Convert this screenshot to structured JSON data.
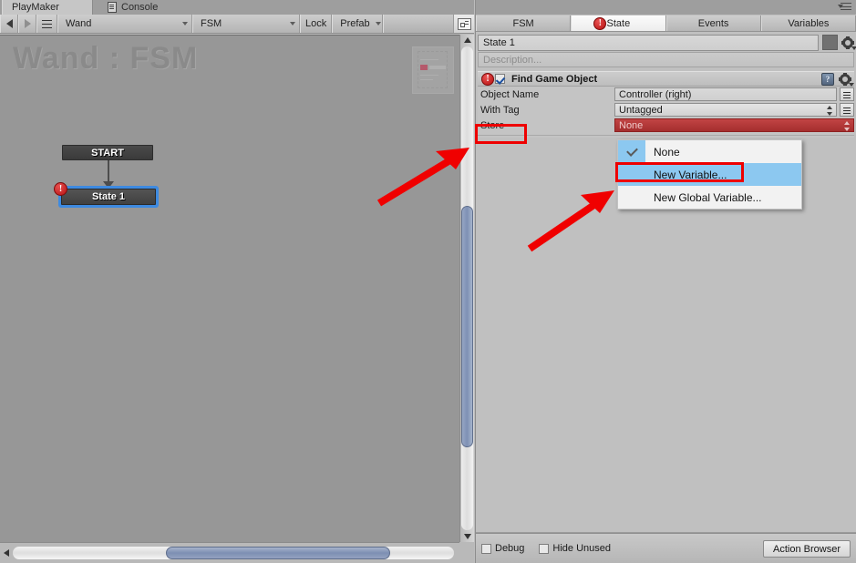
{
  "window_tabs": [
    {
      "label": "PlayMaker",
      "active": true,
      "icon": ""
    },
    {
      "label": "Console",
      "active": false,
      "icon": "console-doc-icon"
    }
  ],
  "toolbar": {
    "back_icon": "triangle-left-icon",
    "forward_icon": "triangle-right-icon",
    "menu_icon": "hamburger-icon",
    "game_object_selector": "Wand",
    "fsm_selector": "FSM",
    "lock_label": "Lock",
    "prefab_label": "Prefab",
    "layout_icon": "layout-icon"
  },
  "graph": {
    "title": "Wand : FSM",
    "start_node": "START",
    "state_node": "State 1",
    "state_error_badge": "!",
    "minimap_name": "minimap"
  },
  "right_panel": {
    "tabs": [
      {
        "label": "FSM",
        "active": false,
        "has_error": false
      },
      {
        "label": "State",
        "active": true,
        "has_error": true
      },
      {
        "label": "Events",
        "active": false,
        "has_error": false
      },
      {
        "label": "Variables",
        "active": false,
        "has_error": false
      }
    ],
    "state_name": "State 1",
    "description_placeholder": "Description...",
    "color_swatch": "#717171",
    "action": {
      "title": "Find Game Object",
      "enabled": true,
      "error_badge": "!",
      "help_label": "?",
      "properties": [
        {
          "label": "Object Name",
          "value": "Controller (right)",
          "type": "text",
          "has_equals_button": true,
          "error": false
        },
        {
          "label": "With Tag",
          "value": "Untagged",
          "type": "popup",
          "has_equals_button": true,
          "error": false
        },
        {
          "label": "Store",
          "value": "None",
          "type": "popup",
          "has_equals_button": false,
          "error": true
        }
      ]
    },
    "dropdown": {
      "open": true,
      "items": [
        {
          "label": "None",
          "checked": true,
          "highlighted": false
        },
        {
          "label": "New Variable...",
          "checked": false,
          "highlighted": true
        },
        {
          "label": "New Global Variable...",
          "checked": false,
          "highlighted": false
        }
      ]
    },
    "bottom_bar": {
      "debug_label": "Debug",
      "debug_checked": false,
      "hide_unused_label": "Hide Unused",
      "hide_unused_checked": false,
      "action_browser_label": "Action Browser"
    }
  },
  "annotations": {
    "accent_color": "#ee0000",
    "boxes": [
      {
        "name": "store-label-highlight"
      },
      {
        "name": "new-variable-highlight"
      }
    ],
    "arrows": [
      {
        "name": "arrow-to-store-row"
      },
      {
        "name": "arrow-to-new-variable"
      }
    ]
  }
}
